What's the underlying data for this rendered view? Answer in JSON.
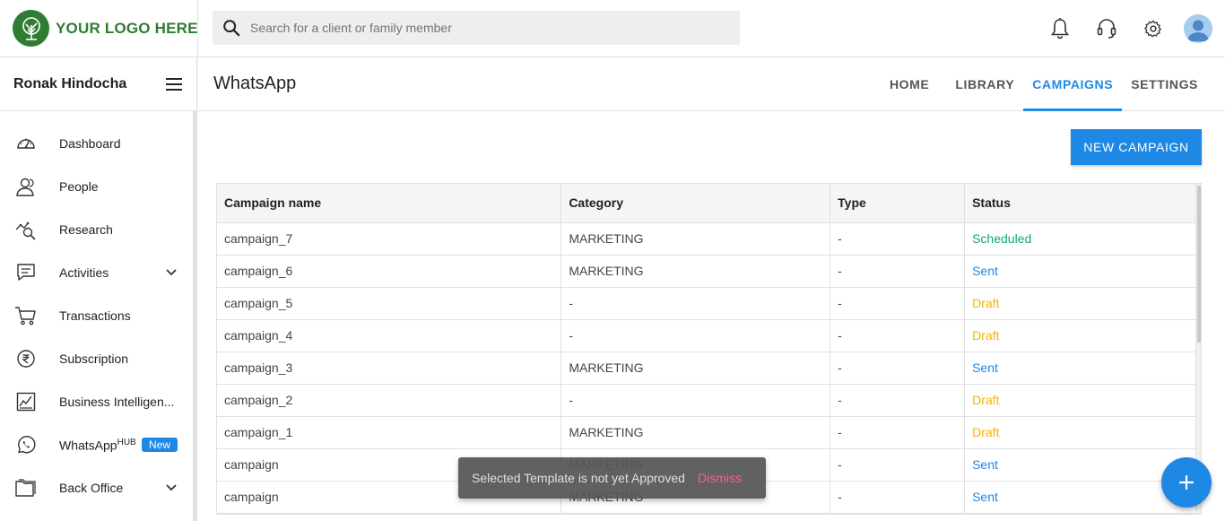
{
  "header": {
    "logo_text": "YOUR LOGO HERE",
    "search_placeholder": "Search for a client or family member",
    "icons": [
      "bell-icon",
      "headset-icon",
      "gear-icon",
      "avatar"
    ]
  },
  "sidebar": {
    "user_name": "Ronak Hindocha",
    "items": [
      {
        "label": "Dashboard",
        "icon": "dashboard-gauge-icon"
      },
      {
        "label": "People",
        "icon": "people-icon"
      },
      {
        "label": "Research",
        "icon": "research-icon"
      },
      {
        "label": "Activities",
        "icon": "chat-lines-icon",
        "expandable": true
      },
      {
        "label": "Transactions",
        "icon": "cart-icon"
      },
      {
        "label": "Subscription",
        "icon": "rupee-icon"
      },
      {
        "label": "Business Intelligen...",
        "icon": "chart-icon"
      },
      {
        "label": "WhatsApp",
        "sup": "HUB",
        "icon": "whatsapp-icon",
        "badge": "New"
      },
      {
        "label": "Back Office",
        "icon": "folder-icon",
        "expandable": true
      }
    ]
  },
  "page": {
    "title": "WhatsApp",
    "tabs": [
      {
        "label": "HOME",
        "active": false
      },
      {
        "label": "LIBRARY",
        "active": false
      },
      {
        "label": "CAMPAIGNS",
        "active": true
      },
      {
        "label": "SETTINGS",
        "active": false
      }
    ],
    "new_campaign_label": "NEW CAMPAIGN"
  },
  "table": {
    "headers": [
      "Campaign name",
      "Category",
      "Type",
      "Status"
    ],
    "rows": [
      {
        "name": "campaign_7",
        "category": "MARKETING",
        "type": "-",
        "status": "Scheduled"
      },
      {
        "name": "campaign_6",
        "category": "MARKETING",
        "type": "-",
        "status": "Sent"
      },
      {
        "name": "campaign_5",
        "category": "-",
        "type": "-",
        "status": "Draft"
      },
      {
        "name": "campaign_4",
        "category": "-",
        "type": "-",
        "status": "Draft"
      },
      {
        "name": "campaign_3",
        "category": "MARKETING",
        "type": "-",
        "status": "Sent"
      },
      {
        "name": "campaign_2",
        "category": "-",
        "type": "-",
        "status": "Draft"
      },
      {
        "name": "campaign_1",
        "category": "MARKETING",
        "type": "-",
        "status": "Draft"
      },
      {
        "name": "campaign",
        "category": "MARKETING",
        "type": "-",
        "status": "Sent"
      },
      {
        "name": "campaign",
        "category": "MARKETING",
        "type": "-",
        "status": "Sent"
      }
    ],
    "status_colors": {
      "Scheduled": "#13a86a",
      "Sent": "#1e88e5",
      "Draft": "#f5b400"
    }
  },
  "toast": {
    "message": "Selected Template is not yet Approved",
    "action": "Dismiss"
  },
  "colors": {
    "accent": "#1e88e5",
    "brand_green": "#2e7d32"
  }
}
